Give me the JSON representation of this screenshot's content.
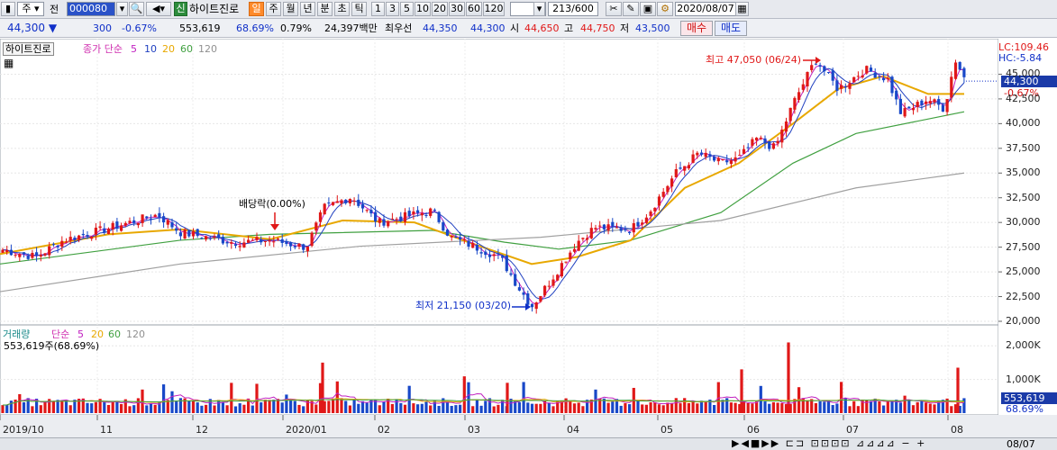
{
  "toolbar": {
    "period_type": "주",
    "compare_label": "전",
    "code": "000080",
    "credit_label": "신",
    "stock_name": "하이트진로",
    "timeframes": [
      "일",
      "주",
      "월",
      "년",
      "분",
      "초",
      "틱"
    ],
    "selected_timeframe": "일",
    "intervals": [
      "1",
      "3",
      "5",
      "10",
      "20",
      "30",
      "60",
      "120"
    ],
    "page_count": "213/600",
    "date": "2020/08/07"
  },
  "quote": {
    "price": "44,300",
    "change": "300",
    "change_pct": "-0.67%",
    "volume": "553,619",
    "volume_ratio": "68.69%",
    "turnover": "0.79%",
    "trade_value": "24,397백만",
    "best_bid_label": "최우선",
    "best_bid": "44,350",
    "best_ask": "44,300",
    "open_label": "시",
    "open": "44,650",
    "high_label": "고",
    "high": "44,750",
    "low_label": "저",
    "low": "43,500",
    "buy_label": "매수",
    "sell_label": "매도"
  },
  "price_panel": {
    "legend_name": "하이트진로",
    "ma_label": "종가 단순",
    "ma_periods": [
      "5",
      "10",
      "20",
      "60",
      "120"
    ],
    "lc": "LC:109.46",
    "hc": "HC:-5.84",
    "current_price": "44,300",
    "current_change": "-0.67%",
    "high_annotation": "최고 47,050 (06/24)",
    "low_annotation": "최저 21,150 (03/20)",
    "dividend_annotation": "배당락(0.00%)"
  },
  "volume_panel": {
    "legend_name": "거래량",
    "ma_label": "단순",
    "ma_periods": [
      "5",
      "20",
      "60",
      "120"
    ],
    "subtitle": "553,619주(68.69%)",
    "current_volume": "553,619",
    "current_pct": "68.69%"
  },
  "colors": {
    "up": "#e01818",
    "down": "#1848c8",
    "ma5": "#c020c0",
    "ma10": "#2040c0",
    "ma20": "#e8a800",
    "ma60": "#40a040",
    "ma120": "#a0a0a0"
  },
  "chart_data": [
    {
      "type": "candlestick",
      "title": "하이트진로",
      "x_tick_labels": [
        "2019/10",
        "11",
        "12",
        "2020/01",
        "02",
        "03",
        "04",
        "05",
        "06",
        "07",
        "08"
      ],
      "y_tick_labels": [
        "45,000",
        "42,500",
        "40,000",
        "37,500",
        "35,000",
        "32,500",
        "30,000",
        "27,500",
        "25,000",
        "22,500",
        "20,000"
      ],
      "ylim": [
        20000,
        47500
      ],
      "x": [
        "2019/10",
        "11",
        "12",
        "2020/01",
        "02",
        "03",
        "04",
        "05",
        "06",
        "07",
        "08"
      ],
      "series": [
        {
          "name": "종가",
          "values": [
            27300,
            29000,
            29500,
            30500,
            30000,
            26500,
            27500,
            32000,
            39000,
            42000,
            44300
          ]
        },
        {
          "name": "20",
          "values": [
            27000,
            28300,
            29200,
            29800,
            30200,
            28000,
            26500,
            31000,
            37000,
            42000,
            43000
          ]
        },
        {
          "name": "60",
          "values": [
            26000,
            27000,
            28000,
            29000,
            29300,
            29000,
            28000,
            28800,
            31500,
            37500,
            41200
          ]
        },
        {
          "name": "120",
          "values": [
            23000,
            24300,
            25500,
            26500,
            27500,
            28000,
            28200,
            29000,
            31000,
            33500,
            35000
          ]
        }
      ],
      "annotations": [
        {
          "text": "최고 47,050 (06/24)",
          "x": "06/24",
          "y": 47050
        },
        {
          "text": "최저 21,150 (03/20)",
          "x": "03/20",
          "y": 21150
        },
        {
          "text": "배당락(0.00%)",
          "x": "2019/12",
          "y": 28500
        }
      ],
      "grid": true
    },
    {
      "type": "bar",
      "title": "거래량",
      "y_tick_labels": [
        "2,000K",
        "1,000K"
      ],
      "ylim": [
        0,
        2300000
      ],
      "x": [
        "2019/10",
        "11",
        "12",
        "2020/01",
        "02",
        "03",
        "04",
        "05",
        "06",
        "07",
        "08"
      ],
      "values": [
        300000,
        350000,
        330000,
        400000,
        380000,
        600000,
        450000,
        500000,
        900000,
        600000,
        553619
      ],
      "grid": true
    }
  ]
}
